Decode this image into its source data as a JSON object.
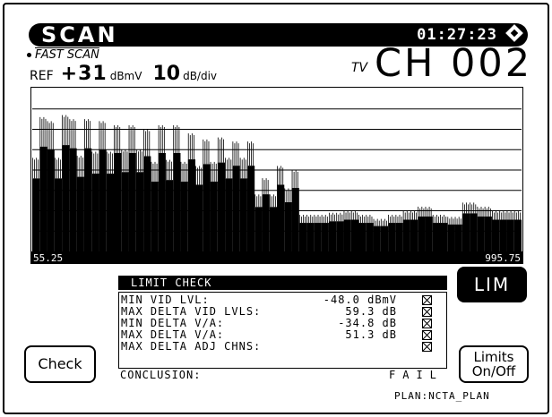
{
  "header": {
    "mode": "SCAN",
    "time": "01:27:23",
    "status_icon": "diamond-icon"
  },
  "scan_mode": "FAST SCAN",
  "reference": {
    "label": "REF",
    "value": "+31",
    "unit": "dBmV",
    "scale_value": "10",
    "scale_unit": "dB/div"
  },
  "channel": {
    "type": "TV",
    "label": "CH 002"
  },
  "spectrum": {
    "start_label": "55.25",
    "stop_label": "995.75",
    "levels_db_below_ref": [
      34,
      14,
      16,
      34,
      13,
      15,
      33,
      15,
      31,
      16,
      31,
      18,
      30,
      18,
      30,
      20,
      36,
      18,
      35,
      18,
      36,
      22,
      38,
      25,
      36,
      24,
      34,
      26,
      34,
      26,
      52,
      44,
      52,
      38,
      49,
      40,
      62,
      62,
      62,
      62,
      61,
      61,
      60,
      60,
      62,
      62,
      64,
      64,
      62,
      62,
      60,
      60,
      58,
      58,
      62,
      62,
      63,
      63,
      56,
      56,
      58,
      58,
      60,
      60,
      60,
      60
    ]
  },
  "limit_check": {
    "title": "LIMIT CHECK",
    "rows": [
      {
        "label": "MIN VID LVL:",
        "value": "-48.0 dBmV",
        "status": "fail"
      },
      {
        "label": "MAX DELTA VID LVLS:",
        "value": "59.3 dB",
        "status": "fail"
      },
      {
        "label": "MIN DELTA V/A:",
        "value": "-34.8 dB",
        "status": "fail"
      },
      {
        "label": "MAX DELTA V/A:",
        "value": "51.3 dB",
        "status": "fail"
      },
      {
        "label": "MAX DELTA ADJ CHNS:",
        "value": "",
        "status": "fail"
      }
    ],
    "conclusion_label": "CONCLUSION:",
    "conclusion_value": "FAIL"
  },
  "buttons": {
    "lim": "LIM",
    "check": "Check",
    "limits_line1": "Limits",
    "limits_line2": "On/Off"
  },
  "footer": {
    "plan": "PLAN:NCTA_PLAN"
  }
}
